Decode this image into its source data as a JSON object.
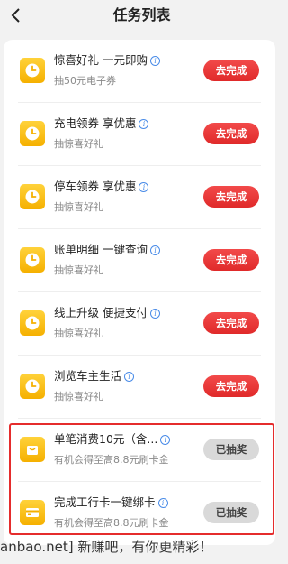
{
  "header": {
    "back_icon": "chevron-left-icon",
    "title": "任务列表"
  },
  "tasks": [
    {
      "title": "惊喜好礼 一元即购",
      "subtitle": "抽50元电子券",
      "button": "去完成",
      "status": "todo",
      "icon": "clock-icon"
    },
    {
      "title": "充电领券 享优惠",
      "subtitle": "抽惊喜好礼",
      "button": "去完成",
      "status": "todo",
      "icon": "clock-icon"
    },
    {
      "title": "停车领券 享优惠",
      "subtitle": "抽惊喜好礼",
      "button": "去完成",
      "status": "todo",
      "icon": "clock-icon"
    },
    {
      "title": "账单明细 一键查询",
      "subtitle": "抽惊喜好礼",
      "button": "去完成",
      "status": "todo",
      "icon": "clock-icon"
    },
    {
      "title": "线上升级 便捷支付",
      "subtitle": "抽惊喜好礼",
      "button": "去完成",
      "status": "todo",
      "icon": "clock-icon"
    },
    {
      "title": "浏览车主生活",
      "subtitle": "抽惊喜好礼",
      "button": "去完成",
      "status": "todo",
      "icon": "clock-icon"
    },
    {
      "title": "单笔消费10元（含...",
      "subtitle": "有机会得至高8.8元刷卡金",
      "button": "已抽奖",
      "status": "done",
      "icon": "shopping-bag-icon"
    },
    {
      "title": "完成工行卡一键绑卡",
      "subtitle": "有机会得至高8.8元刷卡金",
      "button": "已抽奖",
      "status": "done",
      "icon": "card-icon"
    }
  ],
  "footer": {
    "text": "anbao.net] 新赚吧，有你更精彩！"
  },
  "colors": {
    "accent_red": "#e02a2a",
    "icon_yellow": "#f5b000",
    "info_blue": "#4a8ce8",
    "done_gray": "#d9d9d9"
  }
}
